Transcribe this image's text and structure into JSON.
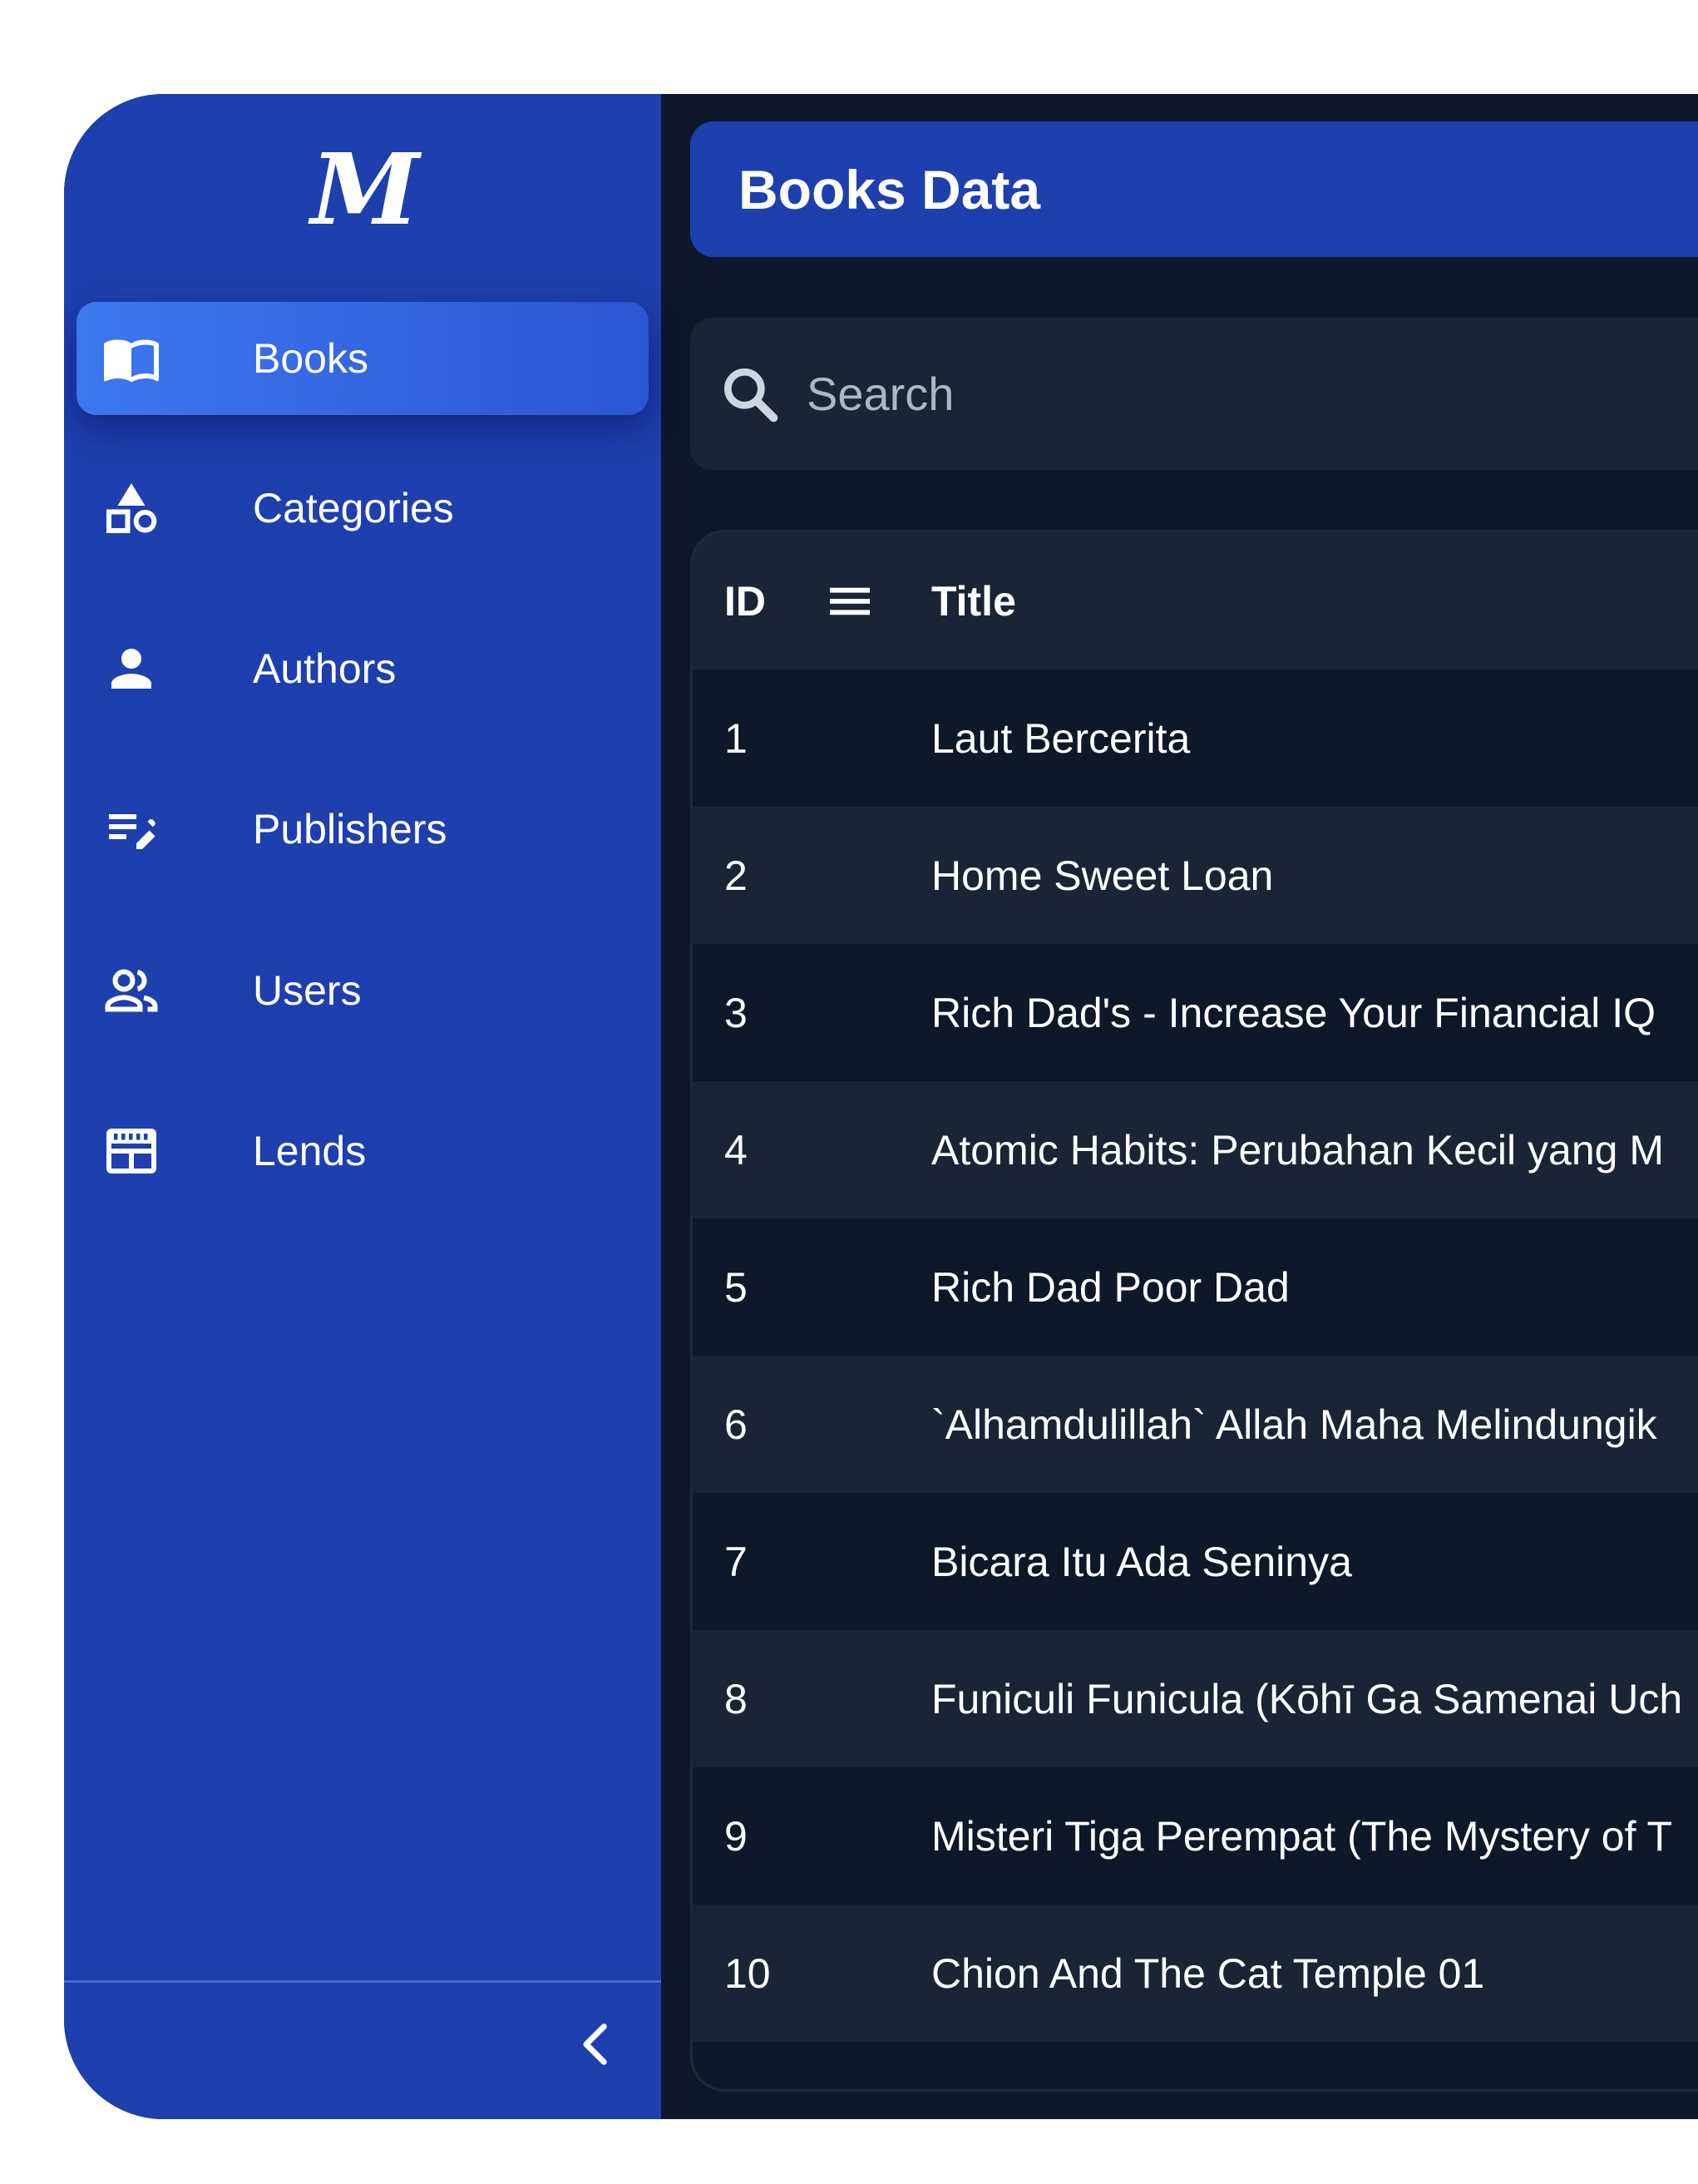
{
  "sidebar": {
    "logo": "M",
    "items": [
      {
        "label": "Books",
        "icon": "open-book-icon",
        "active": true
      },
      {
        "label": "Categories",
        "icon": "shapes-icon",
        "active": false
      },
      {
        "label": "Authors",
        "icon": "person-icon",
        "active": false
      },
      {
        "label": "Publishers",
        "icon": "edit-note-icon",
        "active": false
      },
      {
        "label": "Users",
        "icon": "people-icon",
        "active": false
      },
      {
        "label": "Lends",
        "icon": "table-chart-icon",
        "active": false
      }
    ],
    "collapse_icon": "chevron-left-icon"
  },
  "header": {
    "title": "Books Data"
  },
  "search": {
    "placeholder": "Search",
    "value": ""
  },
  "table": {
    "columns": [
      "ID",
      "Title"
    ],
    "rows": [
      {
        "id": "1",
        "title": "Laut Bercerita"
      },
      {
        "id": "2",
        "title": "Home Sweet Loan"
      },
      {
        "id": "3",
        "title": "Rich Dad's - Increase Your Financial IQ"
      },
      {
        "id": "4",
        "title": "Atomic Habits: Perubahan Kecil yang M"
      },
      {
        "id": "5",
        "title": "Rich Dad Poor Dad"
      },
      {
        "id": "6",
        "title": "`Alhamdulillah` Allah Maha Melindungik"
      },
      {
        "id": "7",
        "title": "Bicara Itu Ada Seninya"
      },
      {
        "id": "8",
        "title": "Funiculi Funicula (Kōhī Ga Samenai Uch"
      },
      {
        "id": "9",
        "title": "Misteri Tiga Perempat (The Mystery of T"
      },
      {
        "id": "10",
        "title": "Chion And The Cat Temple 01"
      }
    ]
  },
  "colors": {
    "sidebar_bg": "#1e3fae",
    "active_item": "#3d78ef",
    "main_bg": "#0f172a",
    "row_alt_bg": "#1a2436",
    "text": "#ffffff"
  }
}
